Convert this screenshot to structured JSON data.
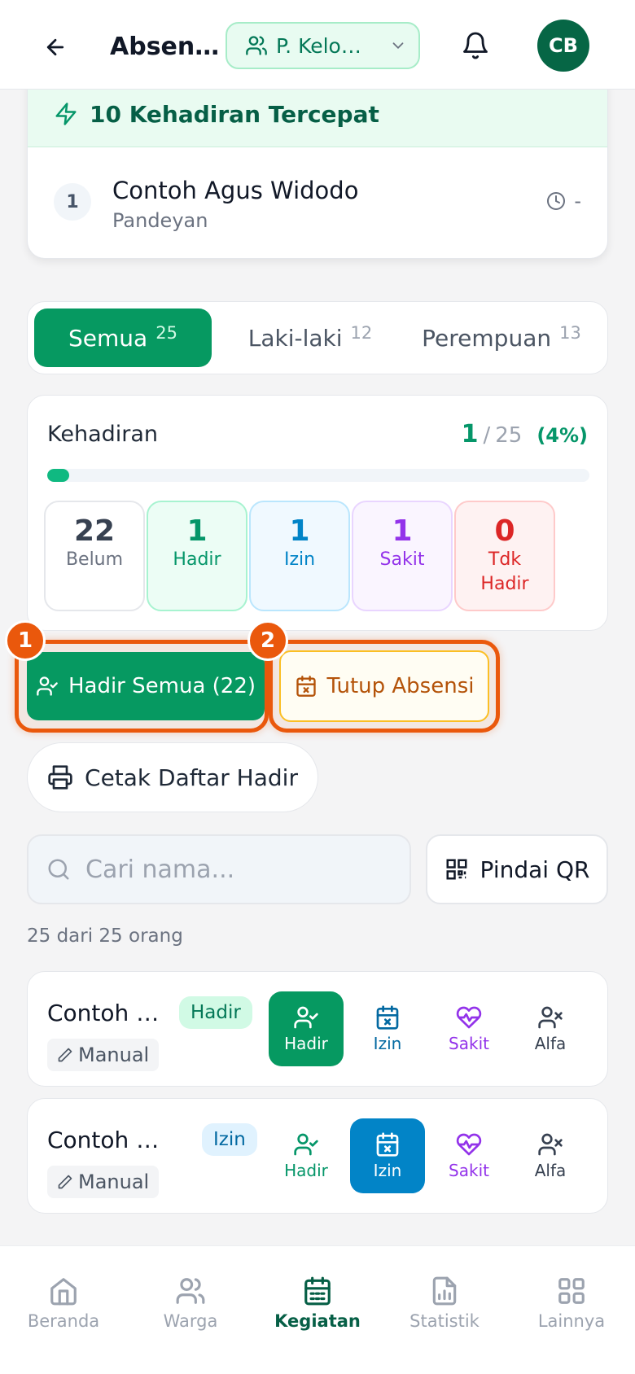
{
  "header": {
    "title": "Absen…",
    "group_label": "P. Kelo…",
    "avatar_initials": "CB"
  },
  "fastest": {
    "title": "10 Kehadiran Tercepat",
    "items": [
      {
        "rank": "1",
        "name": "Contoh Agus Widodo",
        "location": "Pandeyan",
        "time": "-"
      }
    ]
  },
  "filter_tabs": [
    {
      "label": "Semua",
      "count": "25",
      "active": true
    },
    {
      "label": "Laki-laki",
      "count": "12",
      "active": false
    },
    {
      "label": "Perempuan",
      "count": "13",
      "active": false
    }
  ],
  "attendance": {
    "label": "Kehadiran",
    "present": "1",
    "separator": "/",
    "total": "25",
    "percent_text": "(4%)",
    "progress_fraction": 0.04,
    "stats": [
      {
        "value": "22",
        "label": "Belum",
        "color": "#374151",
        "bg": "#ffffff",
        "border": "#e5e7eb"
      },
      {
        "value": "1",
        "label": "Hadir",
        "color": "#059669",
        "bg": "#ecfdf5",
        "border": "#a7f3d0"
      },
      {
        "value": "1",
        "label": "Izin",
        "color": "#0284c7",
        "bg": "#f0f9ff",
        "border": "#bae6fd"
      },
      {
        "value": "1",
        "label": "Sakit",
        "color": "#9333ea",
        "bg": "#faf5ff",
        "border": "#e9d5ff"
      },
      {
        "value": "0",
        "label": "Tdk Hadir",
        "color": "#dc2626",
        "bg": "#fef2f2",
        "border": "#fecaca"
      }
    ]
  },
  "actions": {
    "mark_all_label": "Hadir Semua (22)",
    "mark_all_badge": "1",
    "close_label": "Tutup Absensi",
    "close_badge": "2",
    "print_label": "Cetak Daftar Hadir"
  },
  "search": {
    "placeholder": "Cari nama...",
    "value": "",
    "qr_label": "Pindai QR"
  },
  "result_count": "25 dari 25 orang",
  "members": [
    {
      "name": "Contoh A…",
      "status": "Hadir",
      "method": "Manual",
      "actions": [
        {
          "label": "Hadir",
          "selected": true
        },
        {
          "label": "Izin",
          "selected": false
        },
        {
          "label": "Sakit",
          "selected": false
        },
        {
          "label": "Alfa",
          "selected": false
        }
      ]
    },
    {
      "name": "Contoh Ba…",
      "status": "Izin",
      "method": "Manual",
      "actions": [
        {
          "label": "Hadir",
          "selected": false
        },
        {
          "label": "Izin",
          "selected": true
        },
        {
          "label": "Sakit",
          "selected": false
        },
        {
          "label": "Alfa",
          "selected": false
        }
      ]
    }
  ],
  "bottom_nav": [
    {
      "label": "Beranda",
      "icon": "home-icon",
      "active": false
    },
    {
      "label": "Warga",
      "icon": "users-icon",
      "active": false
    },
    {
      "label": "Kegiatan",
      "icon": "calendar-icon",
      "active": true
    },
    {
      "label": "Statistik",
      "icon": "chart-file-icon",
      "active": false
    },
    {
      "label": "Lainnya",
      "icon": "grid-icon",
      "active": false
    }
  ],
  "colors": {
    "brand": "#069961",
    "brand_dark": "#065f46",
    "highlight": "#ea580c",
    "izin": "#0284c7",
    "sakit": "#9333ea",
    "alfa": "#374151"
  }
}
